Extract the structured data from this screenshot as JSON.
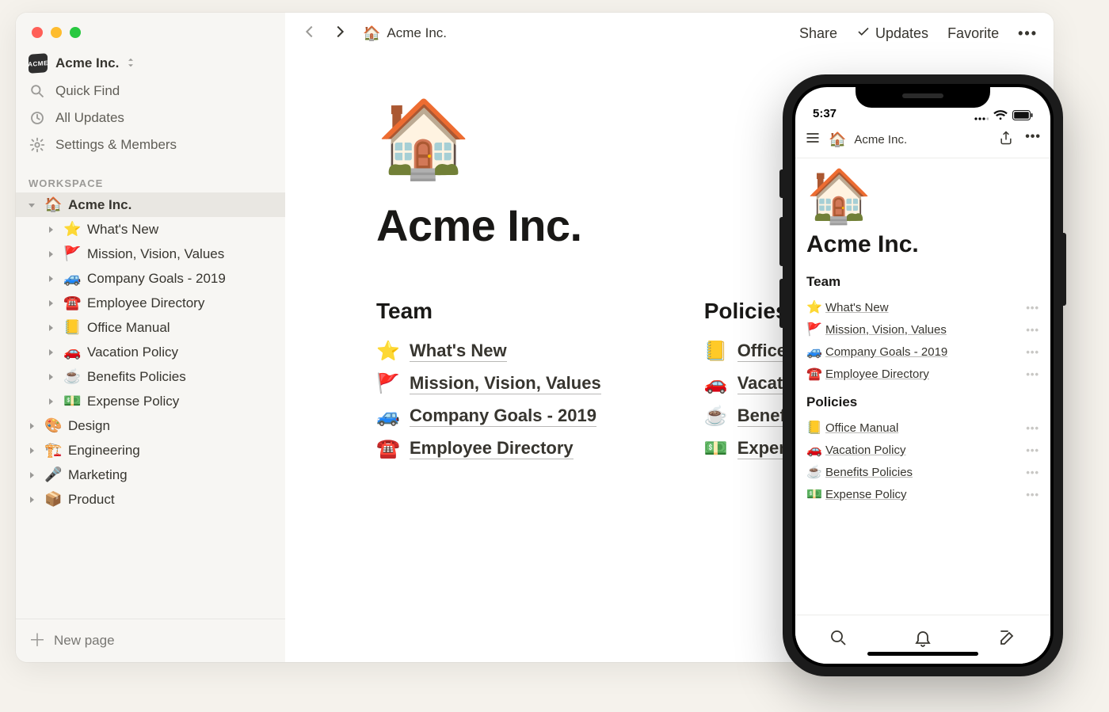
{
  "workspace": {
    "name": "Acme Inc.",
    "quick_find": "Quick Find",
    "all_updates": "All Updates",
    "settings": "Settings & Members",
    "heading": "WORKSPACE",
    "new_page": "New page"
  },
  "tree": {
    "root": {
      "emoji": "🏠",
      "label": "Acme Inc."
    },
    "children": [
      {
        "emoji": "⭐",
        "label": "What's New"
      },
      {
        "emoji": "🚩",
        "label": "Mission, Vision, Values"
      },
      {
        "emoji": "🚙",
        "label": "Company Goals - 2019"
      },
      {
        "emoji": "☎️",
        "label": "Employee Directory"
      },
      {
        "emoji": "📒",
        "label": "Office Manual"
      },
      {
        "emoji": "🚗",
        "label": "Vacation Policy"
      },
      {
        "emoji": "☕",
        "label": "Benefits Policies"
      },
      {
        "emoji": "💵",
        "label": "Expense Policy"
      }
    ],
    "siblings": [
      {
        "emoji": "🎨",
        "label": "Design"
      },
      {
        "emoji": "🏗️",
        "label": "Engineering"
      },
      {
        "emoji": "🎤",
        "label": "Marketing"
      },
      {
        "emoji": "📦",
        "label": "Product"
      }
    ]
  },
  "topbar": {
    "crumb_emoji": "🏠",
    "crumb": "Acme Inc.",
    "share": "Share",
    "updates": "Updates",
    "favorite": "Favorite"
  },
  "page": {
    "emoji": "🏠",
    "title": "Acme Inc.",
    "sections": [
      {
        "heading": "Team",
        "links": [
          {
            "emoji": "⭐",
            "label": "What's New"
          },
          {
            "emoji": "🚩",
            "label": "Mission, Vision, Values"
          },
          {
            "emoji": "🚙",
            "label": "Company Goals - 2019"
          },
          {
            "emoji": "☎️",
            "label": "Employee Directory"
          }
        ]
      },
      {
        "heading": "Policies",
        "links": [
          {
            "emoji": "📒",
            "label": "Office Manual"
          },
          {
            "emoji": "🚗",
            "label": "Vacation Policy"
          },
          {
            "emoji": "☕",
            "label": "Benefits Policies"
          },
          {
            "emoji": "💵",
            "label": "Expense Policy"
          }
        ]
      }
    ]
  },
  "mobile": {
    "time": "5:37",
    "crumb_emoji": "🏠",
    "crumb": "Acme Inc.",
    "emoji": "🏠",
    "title": "Acme Inc.",
    "sections": [
      {
        "heading": "Team",
        "links": [
          {
            "emoji": "⭐",
            "label": "What's New"
          },
          {
            "emoji": "🚩",
            "label": "Mission, Vision, Values"
          },
          {
            "emoji": "🚙",
            "label": "Company Goals - 2019"
          },
          {
            "emoji": "☎️",
            "label": "Employee Directory"
          }
        ]
      },
      {
        "heading": "Policies",
        "links": [
          {
            "emoji": "📒",
            "label": "Office Manual"
          },
          {
            "emoji": "🚗",
            "label": "Vacation Policy"
          },
          {
            "emoji": "☕",
            "label": "Benefits Policies"
          },
          {
            "emoji": "💵",
            "label": "Expense Policy"
          }
        ]
      }
    ]
  }
}
